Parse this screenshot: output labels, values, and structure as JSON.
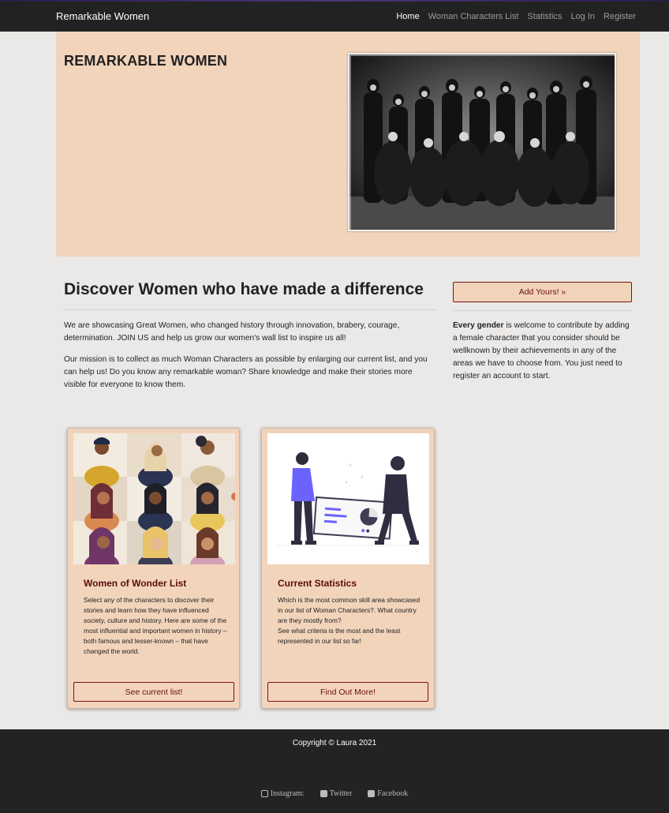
{
  "nav": {
    "brand": "Remarkable Women",
    "links": [
      "Home",
      "Woman Characters List",
      "Statistics",
      "Log In",
      "Register"
    ]
  },
  "hero": {
    "title": "REMARKABLE WOMEN"
  },
  "main": {
    "heading": "Discover Women who have made a difference",
    "paragraph1": "We are showcasing Great Women, who changed history through innovation, brabery, courage, determination. JOIN US and help us grow our women's wall list to inspire us all!",
    "paragraph2": "Our mission is to collect as much Woman Characters as possible by enlarging our current list, and you can help us! Do you know any remarkable woman? Share knowledge and make their stories more visible for everyone to know them."
  },
  "sidebar": {
    "button": "Add Yours! »",
    "bold": "Every gender",
    "text": " is welcome to contribute by adding a female character that you consider should be wellknown by their achievements in any of the areas we have to choose from. You just need to register an account to start."
  },
  "cards": [
    {
      "title": "Women of Wonder List",
      "text": "Select any of the characters to discover their stories and learn how they have influenced society, culture and history. Here are some of the most influential and important women in history – both famous and lesser-known – that have changed the world.",
      "button": "See current list!"
    },
    {
      "title": "Current Statistics",
      "text": "Which is the most common skill area showcased in our list of Woman Characters?. What country are they mostly from?\nSee what criteria is the most and the least represented in our list so far!",
      "button": "Find Out More!"
    }
  ],
  "footer": {
    "copyright": "Copyright © Laura 2021",
    "social": [
      "Instagram:",
      "Twitter",
      "Facebook"
    ]
  },
  "colors": {
    "accent": "#f2d4bb",
    "navbar": "#222222",
    "button_border": "#7a1212"
  }
}
